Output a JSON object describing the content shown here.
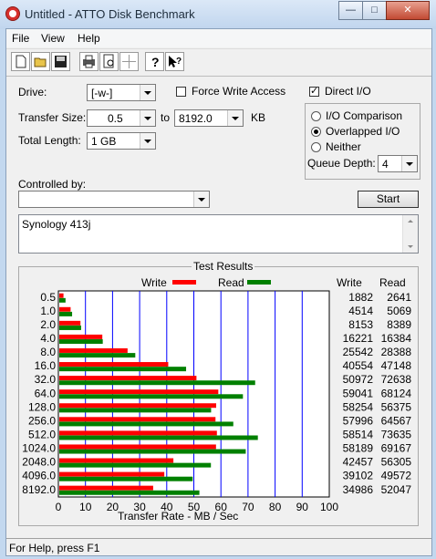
{
  "window": {
    "title": "Untitled - ATTO Disk Benchmark"
  },
  "menu": [
    "File",
    "View",
    "Help"
  ],
  "toolbar": [
    "new-icon",
    "open-icon",
    "save-icon",
    "print-icon",
    "print-preview-icon",
    "move-icon",
    "help-icon",
    "context-help-icon"
  ],
  "settings": {
    "drive_label": "Drive:",
    "drive_value": "[-w-]",
    "transfer_size_label": "Transfer Size:",
    "transfer_from": "0.5",
    "to_label": "to",
    "transfer_to": "8192.0",
    "kb_label": "KB",
    "total_length_label": "Total Length:",
    "total_length": "1 GB",
    "force_write_label": "Force Write Access",
    "force_write_checked": false,
    "direct_io_label": "Direct I/O",
    "direct_io_checked": true,
    "io_options": [
      "I/O Comparison",
      "Overlapped I/O",
      "Neither"
    ],
    "io_selected": 1,
    "queue_depth_label": "Queue Depth:",
    "queue_depth": "4",
    "controlled_by_label": "Controlled by:",
    "controlled_by": "",
    "start_label": "Start",
    "description": "Synology 413j"
  },
  "results": {
    "group_title": "Test Results",
    "write_legend": "Write",
    "read_legend": "Read",
    "write_header": "Write",
    "read_header": "Read",
    "write_color": "#ff0000",
    "read_color": "#008000"
  },
  "chart_data": {
    "type": "bar",
    "orientation": "horizontal",
    "categories": [
      "0.5",
      "1.0",
      "2.0",
      "4.0",
      "8.0",
      "16.0",
      "32.0",
      "64.0",
      "128.0",
      "256.0",
      "512.0",
      "1024.0",
      "2048.0",
      "4096.0",
      "8192.0"
    ],
    "series": [
      {
        "name": "Write",
        "color": "#ff0000",
        "values": [
          1882,
          4514,
          8153,
          16221,
          25542,
          40554,
          50972,
          59041,
          58254,
          57996,
          58514,
          58189,
          42457,
          39102,
          34986
        ]
      },
      {
        "name": "Read",
        "color": "#008000",
        "values": [
          2641,
          5069,
          8389,
          16384,
          28388,
          47148,
          72638,
          68124,
          56375,
          64567,
          73635,
          69167,
          56305,
          49572,
          52047
        ]
      }
    ],
    "value_unit": "KB/s",
    "axis_ticks": [
      0,
      10,
      20,
      30,
      40,
      50,
      60,
      70,
      80,
      90,
      100
    ],
    "xlabel": "Transfer Rate - MB / Sec",
    "xlim": [
      0,
      100
    ],
    "grid": true
  },
  "status": {
    "text": "For Help, press F1"
  }
}
